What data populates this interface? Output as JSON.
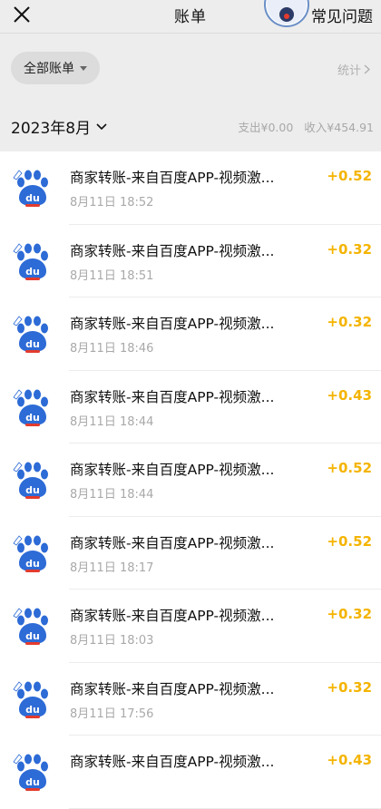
{
  "header": {
    "title": "账单",
    "faq_label": "常见问题",
    "close_icon": "close-icon"
  },
  "filter": {
    "label": "全部账单",
    "stats_label": "统计"
  },
  "month": {
    "label": "2023年8月",
    "expense": "支出¥0.00",
    "income": "收入¥454.91"
  },
  "transactions": [
    {
      "title": "商家转账-来自百度APP-视频激...",
      "time": "8月11日 18:52",
      "amount": "+0.52"
    },
    {
      "title": "商家转账-来自百度APP-视频激...",
      "time": "8月11日 18:51",
      "amount": "+0.32"
    },
    {
      "title": "商家转账-来自百度APP-视频激...",
      "time": "8月11日 18:46",
      "amount": "+0.32"
    },
    {
      "title": "商家转账-来自百度APP-视频激...",
      "time": "8月11日 18:44",
      "amount": "+0.43"
    },
    {
      "title": "商家转账-来自百度APP-视频激...",
      "time": "8月11日 18:44",
      "amount": "+0.52"
    },
    {
      "title": "商家转账-来自百度APP-视频激...",
      "time": "8月11日 18:17",
      "amount": "+0.52"
    },
    {
      "title": "商家转账-来自百度APP-视频激...",
      "time": "8月11日 18:03",
      "amount": "+0.32"
    },
    {
      "title": "商家转账-来自百度APP-视频激...",
      "time": "8月11日 17:56",
      "amount": "+0.32"
    },
    {
      "title": "商家转账-来自百度APP-视频激...",
      "time": "",
      "amount": "+0.43"
    }
  ],
  "colors": {
    "amount": "#f4b400",
    "baidu_blue": "#2d6bd6",
    "baidu_red": "#e33b2e"
  }
}
